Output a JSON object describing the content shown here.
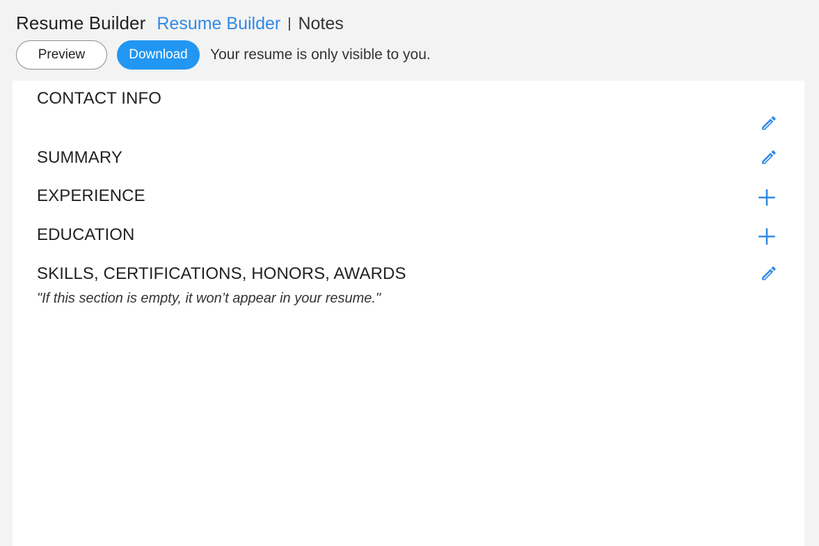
{
  "header": {
    "app_title": "Resume Builder",
    "nav": {
      "active_label": "Resume Builder",
      "divider": "|",
      "notes_label": "Notes"
    },
    "actions": {
      "preview_label": "Preview",
      "download_label": "Download",
      "visibility_note": "Your resume is only visible to you."
    }
  },
  "sections": {
    "contact": {
      "title": "CONTACT INFO",
      "action_icon": "pencil-icon"
    },
    "summary": {
      "title": "SUMMARY",
      "action_icon": "pencil-icon"
    },
    "experience": {
      "title": "EXPERIENCE",
      "action_icon": "plus-icon"
    },
    "education": {
      "title": "EDUCATION",
      "action_icon": "plus-icon"
    },
    "skills": {
      "title": "SKILLS, CERTIFICATIONS, HONORS, AWARDS",
      "note": "\"If this section is empty, it won’t appear in your resume.\"",
      "action_icon": "pencil-icon"
    }
  },
  "colors": {
    "accent": "#2196f3",
    "link": "#2f8ae6",
    "background": "#f3f3f3",
    "card": "#ffffff",
    "text": "#222222"
  }
}
